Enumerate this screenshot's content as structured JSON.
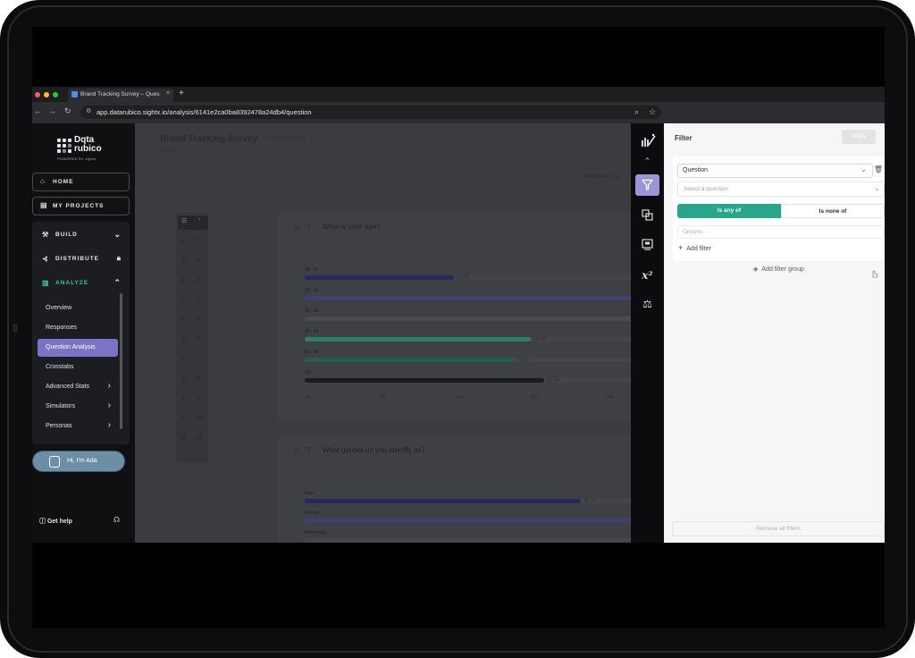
{
  "browser": {
    "tab_title": "Brand Tracking Survey – Ques",
    "tab_close": "×",
    "new_tab": "+",
    "url": "app.datarubico.sightx.io/analysis/6141e2ca0ba8392478a24db4/question",
    "traffic_lights": [
      "#ff5f57",
      "#febc2e",
      "#28c840"
    ]
  },
  "sidebar": {
    "logo_line1": "Dqta",
    "logo_line2": "rubico",
    "logo_sub": "POWERED BY sightx",
    "home": "HOME",
    "projects": "MY PROJECTS",
    "build": "BUILD",
    "distribute": "DISTRIBUTE",
    "analyze": "ANALYZE",
    "items": [
      {
        "label": "Overview"
      },
      {
        "label": "Responses"
      },
      {
        "label": "Question Analysis"
      },
      {
        "label": "Crosstabs"
      },
      {
        "label": "Advanced Stats"
      },
      {
        "label": "Simulators"
      },
      {
        "label": "Personas"
      }
    ],
    "ada": "Hi, I'm Ada",
    "help": "Get help"
  },
  "main": {
    "title": "Brand Tracking Survey",
    "title_tag": "EXPLORATORY",
    "subtitle": "Live at",
    "date_label": "Start Date",
    "date_sep": "/",
    "date_trunc": "Ei",
    "question_numbers": [
      "1",
      "2",
      "3",
      "4",
      "5",
      "6",
      "7",
      "8",
      "9",
      "10",
      "11"
    ],
    "q1": {
      "num": "1",
      "text": "What is your age?",
      "bars": [
        {
          "label": "18 -24",
          "fill": 0.45,
          "color": "#2a2860",
          "value": "19.9%"
        },
        {
          "label": "25 - 34",
          "fill": 1.0,
          "color": "#423f73",
          "value": ""
        },
        {
          "label": "35 - 44",
          "fill": 1.0,
          "color": "#4a4b50",
          "value": ""
        },
        {
          "label": "45 - 54",
          "fill": 0.68,
          "color": "#2c7d6d",
          "value": "29.9%"
        },
        {
          "label": "55 - 64",
          "fill": 0.63,
          "color": "#225c55",
          "value": "27.4%"
        },
        {
          "label": "65+",
          "fill": 0.72,
          "color": "#1a1b1e",
          "value": "31.5%"
        }
      ],
      "axis": [
        "0%",
        "5%",
        "10%",
        "15%",
        "20%"
      ]
    },
    "q2": {
      "num": "2",
      "text": "What gender do you identify as?",
      "bars": [
        {
          "label": "Male",
          "fill": 0.83,
          "color": "#2a2860",
          "value": "44.1%"
        },
        {
          "label": "Female",
          "fill": 1.0,
          "color": "#423f73",
          "value": ""
        },
        {
          "label": "Non-binary",
          "fill": 0.0,
          "color": "#2a2860",
          "value": ""
        }
      ]
    }
  },
  "filter": {
    "title": "Filter",
    "apply": "Apply",
    "type_select": "Question",
    "question_placeholder": "Select a question",
    "is_any_of": "Is any of",
    "is_none_of": "Is none of",
    "options_placeholder": "Options",
    "add_filter": "Add filter",
    "add_group": "Add filter group",
    "remove_all": "Remove all filters"
  },
  "rail": [
    "magic-wand-chart-icon",
    "chevron-up-icon",
    "filter-icon",
    "compare-icon",
    "dashboard-icon",
    "superscript-x2-icon",
    "balance-scale-icon"
  ]
}
